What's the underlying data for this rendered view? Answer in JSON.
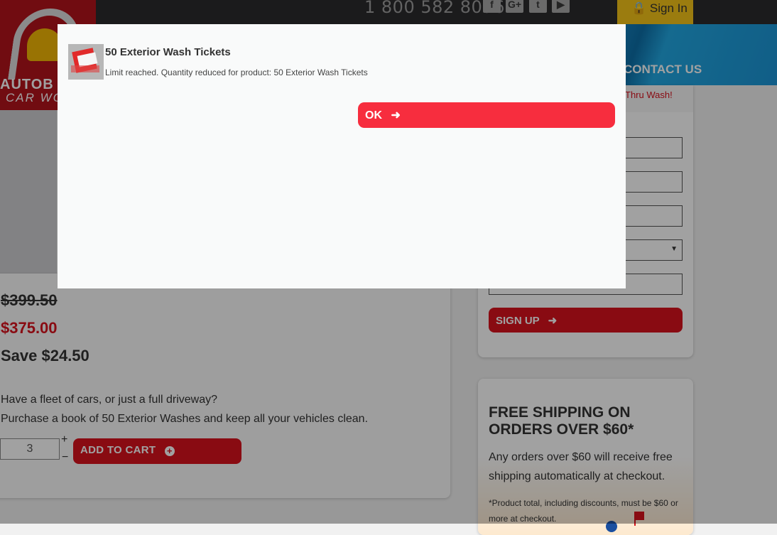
{
  "header": {
    "phone": "1 800 582 8096",
    "social_icons": [
      {
        "name": "facebook-icon",
        "glyph": "f"
      },
      {
        "name": "google-plus-icon",
        "glyph": "G+"
      },
      {
        "name": "twitter-icon",
        "glyph": "t"
      },
      {
        "name": "youtube-icon",
        "glyph": "▶"
      }
    ],
    "sign_in_label": "Sign In",
    "nav_contact": "CONTACT US",
    "logo_text_line1": "AUTOB",
    "logo_text_line2": "CAR WO"
  },
  "product": {
    "old_price": "$399.50",
    "new_price": "$375.00",
    "save": "Save $24.50",
    "description_line1": "Have a fleet of cars, or just a full driveway?",
    "description_line2": "Purchase a book of 50 Exterior Washes and keep all your vehicles clean.",
    "quantity": "3",
    "plus": "+",
    "minus": "−",
    "add_to_cart_label": "ADD TO CART"
  },
  "sidebar": {
    "promo_text": "Thru Wash!",
    "sign_up_label": "SIGN UP",
    "shipping_title": "FREE SHIPPING ON ORDERS OVER $60*",
    "shipping_body": "Any orders over $60 will receive free shipping automatically at checkout.",
    "shipping_note": "*Product total, including discounts, must be $60 or more at checkout."
  },
  "modal": {
    "title": "50 Exterior Wash Tickets",
    "message": "Limit reached. Quantity reduced for product: 50 Exterior Wash Tickets",
    "ok_label": "OK"
  },
  "colors": {
    "brand_red": "#d9121e",
    "ok_red": "#f72d3e",
    "nav_blue": "#1689c6",
    "sign_in_yellow": "#f5c518"
  }
}
